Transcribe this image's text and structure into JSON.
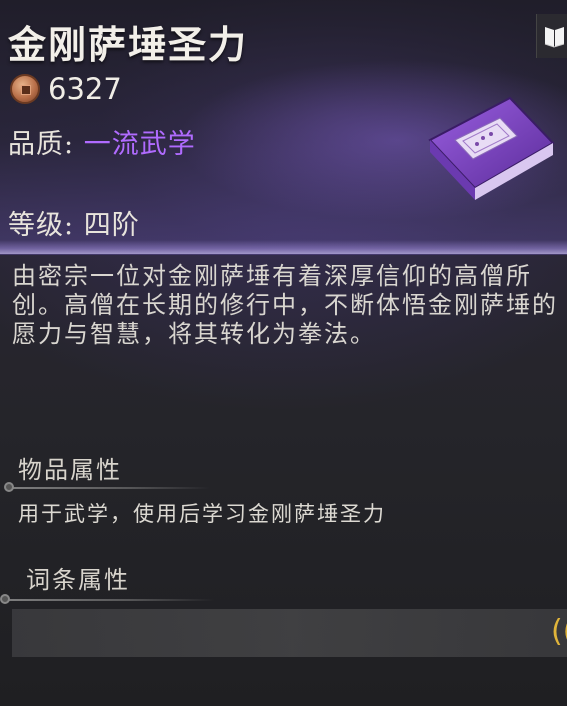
{
  "item": {
    "title": "金刚萨埵圣力",
    "price": "6327",
    "quality_label": "品质:",
    "quality_value": "一流武学",
    "level_label": "等级:",
    "level_value": "四阶",
    "description": "由密宗一位对金刚萨埵有着深厚信仰的高僧所创。高僧在长期的修行中，不断体悟金刚萨埵的愿力与智慧，将其转化为拳法。"
  },
  "sections": {
    "item_props_title": "物品属性",
    "item_props_text": "用于武学，使用后学习金刚萨埵圣力",
    "entry_props_title": "词条属性",
    "entry_props_partial": "(("
  },
  "colors": {
    "quality_accent": "#b06bff",
    "bracket_gold": "#e0b43a"
  },
  "icons": {
    "coin": "copper-coin-icon",
    "book": "book-icon",
    "item": "manual-book-item-icon"
  }
}
